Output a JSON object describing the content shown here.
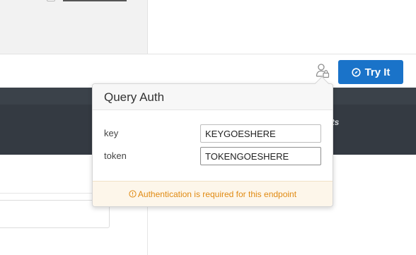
{
  "toolbar": {
    "try_button_label": "Try It",
    "try_button_icon": "compass-icon",
    "auth_icon": "user-lock-icon"
  },
  "background": {
    "band_text": "ults"
  },
  "auth_popover": {
    "title": "Query Auth",
    "fields": [
      {
        "label": "key",
        "value": "KEYGOESHERE"
      },
      {
        "label": "token",
        "value": "TOKENGOESHERE"
      }
    ],
    "notice_icon": "info-circle-icon",
    "notice": "Authentication is required for this endpoint"
  },
  "colors": {
    "accent": "#1a73c9",
    "dark_band": "#343a42",
    "notice_text": "#e08a12",
    "notice_bg": "#fdf6ea"
  }
}
